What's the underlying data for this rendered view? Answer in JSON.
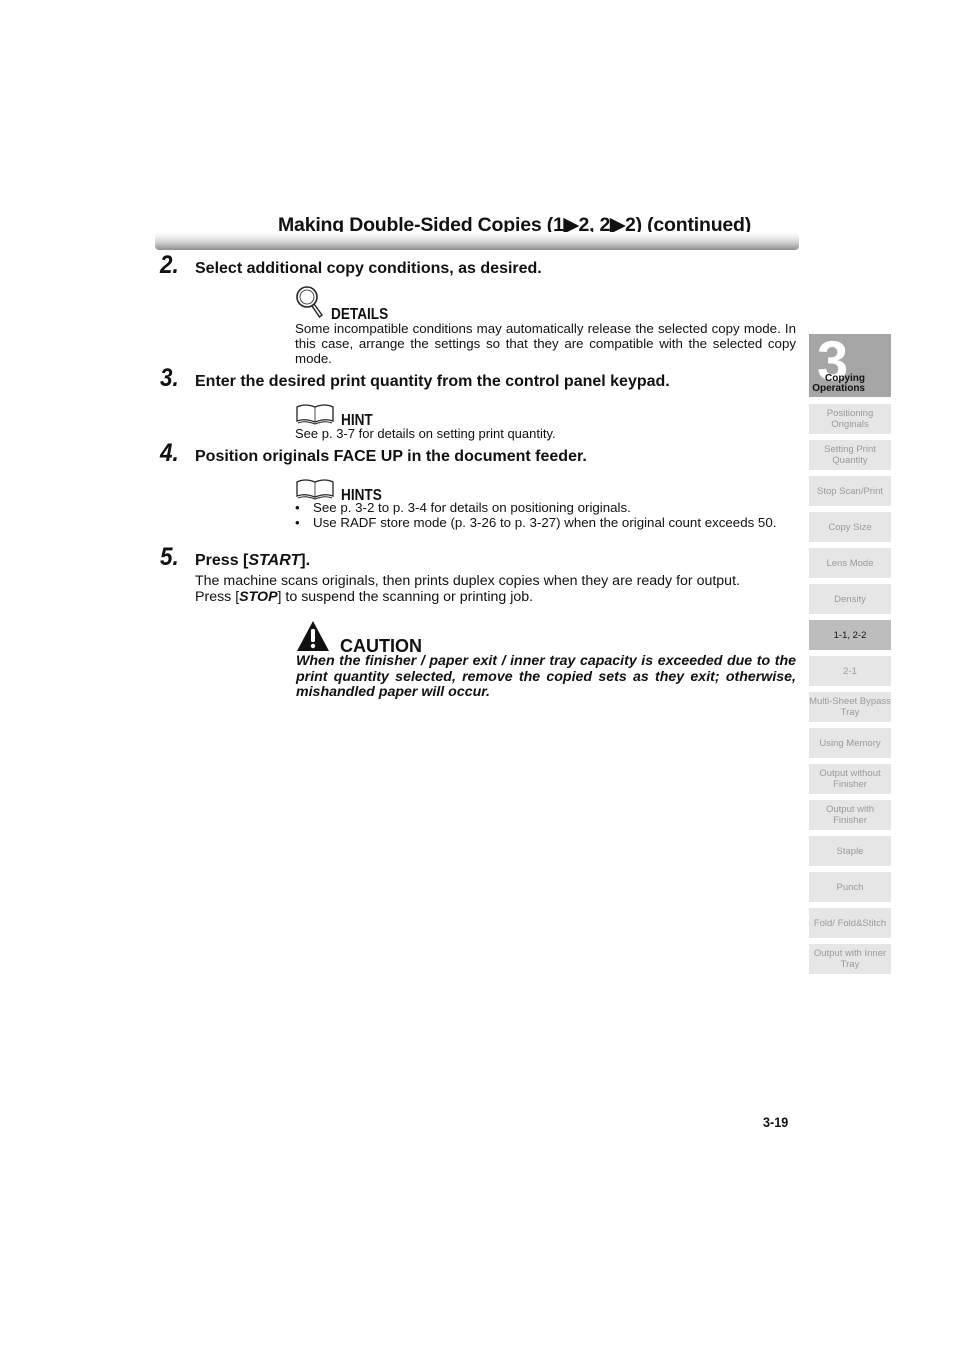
{
  "header": {
    "title": "Making Double-Sided Copies (1▶2, 2▶2) (continued)"
  },
  "steps": [
    {
      "number": "2.",
      "text": "Select additional copy conditions, as desired.",
      "note": {
        "type": "details",
        "icon": "magnifier-icon",
        "label": "DETAILS",
        "body": "Some incompatible conditions may automatically release the selected copy mode. In this case, arrange the settings so that they are compatible with the selected copy mode."
      }
    },
    {
      "number": "3.",
      "text": "Enter the desired print quantity from the control panel keypad.",
      "note": {
        "type": "hint",
        "icon": "open-book-icon",
        "label": "HINT",
        "body": "See p. 3-7 for details on setting print quantity."
      }
    },
    {
      "number": "4.",
      "text": "Position originals FACE UP in the document feeder.",
      "note": {
        "type": "hints",
        "icon": "open-book-icon",
        "label": "HINTS",
        "bullets": [
          "See p. 3-2 to p. 3-4 for details on positioning originals.",
          "Use RADF store mode (p. 3-26 to p. 3-27) when the original count exceeds 50."
        ]
      }
    },
    {
      "number": "5.",
      "text_prefix": "Press [",
      "text_key": "START",
      "text_suffix": "].",
      "body_line1": "The machine scans originals, then prints duplex copies when they are ready for output.",
      "body_line2_prefix": "Press [",
      "body_line2_key": "STOP",
      "body_line2_suffix": "] to suspend the scanning or printing job."
    }
  ],
  "caution": {
    "icon": "warning-triangle-icon",
    "label": "CAUTION",
    "body": "When the finisher / paper exit / inner tray capacity is exceeded due to the print quantity selected, remove the copied sets as they exit; otherwise, mishandled paper will occur."
  },
  "sidebar": {
    "chapter_number": "3",
    "chapter_label_line1": "Copying",
    "chapter_label_line2": "Operations",
    "tabs": [
      {
        "label": "Positioning Originals",
        "active": false
      },
      {
        "label": "Setting Print Quantity",
        "active": false
      },
      {
        "label": "Stop Scan/Print",
        "active": false
      },
      {
        "label": "Copy Size",
        "active": false
      },
      {
        "label": "Lens Mode",
        "active": false
      },
      {
        "label": "Density",
        "active": false
      },
      {
        "label": "1-1, 2-2",
        "active": true
      },
      {
        "label": "2-1",
        "active": false
      },
      {
        "label": "Multi-Sheet Bypass Tray",
        "active": false
      },
      {
        "label": "Using Memory",
        "active": false
      },
      {
        "label": "Output without Finisher",
        "active": false
      },
      {
        "label": "Output with Finisher",
        "active": false
      },
      {
        "label": "Staple",
        "active": false
      },
      {
        "label": "Punch",
        "active": false
      },
      {
        "label": "Fold/ Fold&Stitch",
        "active": false
      },
      {
        "label": "Output with Inner Tray",
        "active": false
      }
    ]
  },
  "footer": {
    "page_number": "3-19"
  }
}
